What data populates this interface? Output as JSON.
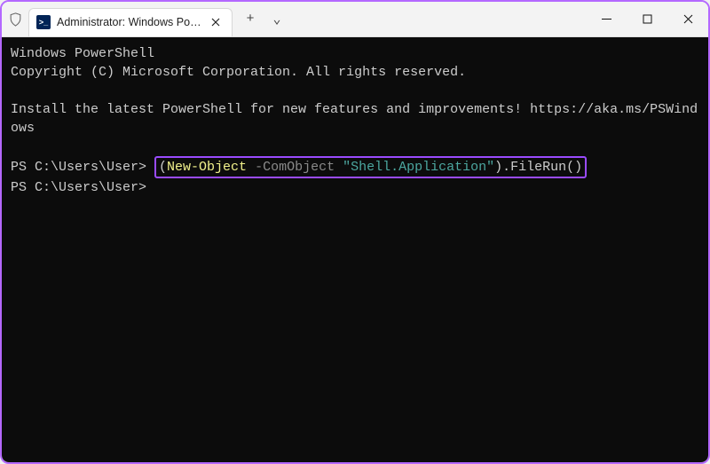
{
  "titlebar": {
    "tab_icon_text": ">_",
    "tab_title": "Administrator: Windows Powe",
    "new_tab_label": "+",
    "dropdown_label": "⌄"
  },
  "terminal": {
    "banner_line1": "Windows PowerShell",
    "banner_line2": "Copyright (C) Microsoft Corporation. All rights reserved.",
    "notice": "Install the latest PowerShell for new features and improvements! https://aka.ms/PSWindows",
    "prompt1": "PS C:\\Users\\User> ",
    "prompt2": "PS C:\\Users\\User> ",
    "cmd": {
      "open_paren": "(",
      "new_object": "New-Object",
      "space1": " ",
      "param_flag": "-ComObject",
      "space2": " ",
      "string_arg": "\"Shell.Application\"",
      "close_paren": ")",
      "method": ".FileRun()",
      "raw": "(New-Object -ComObject \"Shell.Application\").FileRun()"
    }
  },
  "chart_data": null
}
